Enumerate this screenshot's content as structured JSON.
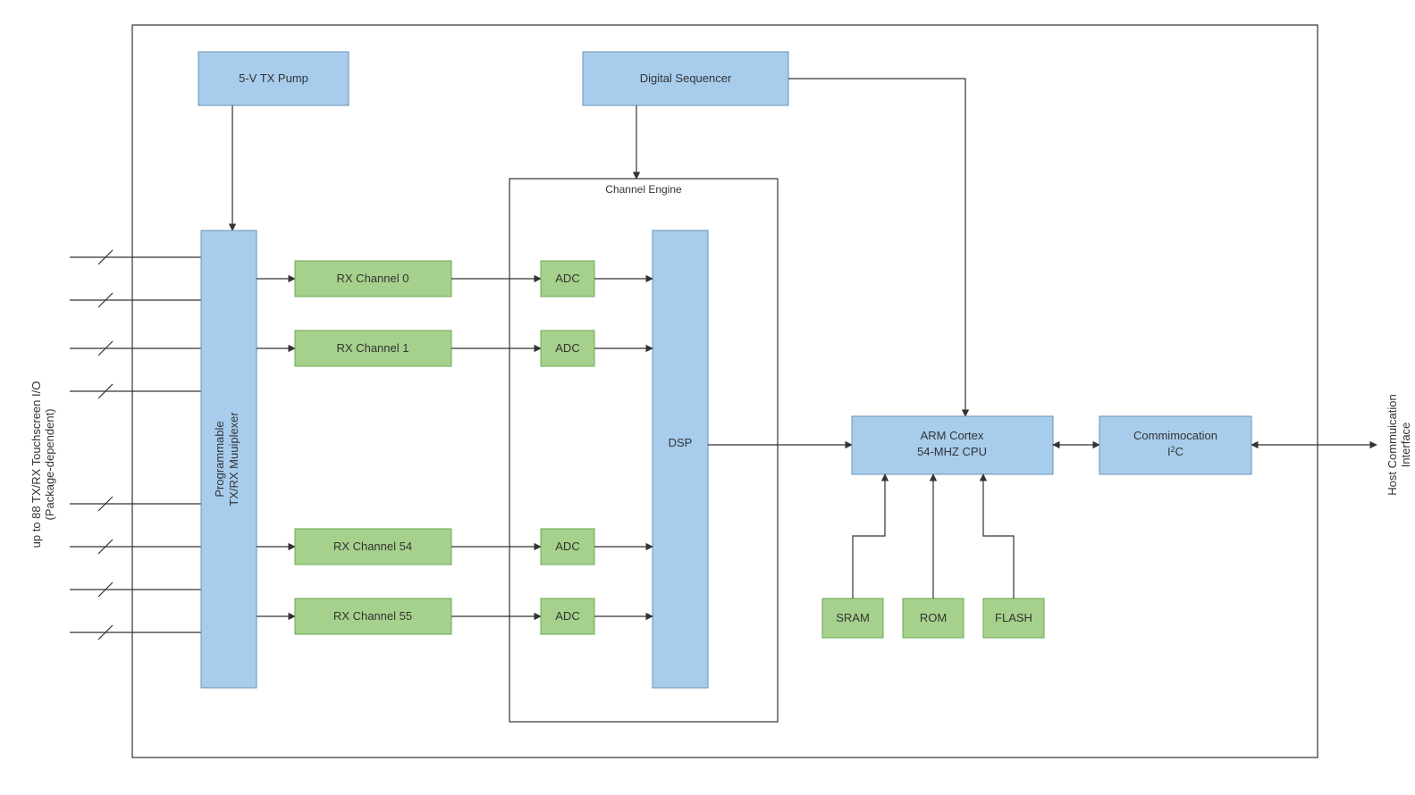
{
  "left_label_line1": "up to 88 TX/RX Touchscreen I/O",
  "left_label_line2": "(Package-dependent)",
  "right_label_line1": "Host Commuication",
  "right_label_line2": "Interface",
  "blocks": {
    "tx_pump": "5-V TX Pump",
    "digital_sequencer": "Digital Sequencer",
    "channel_engine_title": "Channel Engine",
    "mux_line1": "Programmable",
    "mux_line2": "TX/RX Muuiplexer",
    "rx0": "RX Channel 0",
    "rx1": "RX Channel 1",
    "rx54": "RX Channel 54",
    "rx55": "RX Channel 55",
    "adc": "ADC",
    "dsp": "DSP",
    "cpu_line1": "ARM Cortex",
    "cpu_line2": "54-MHZ CPU",
    "comm_line1": "Commimocation",
    "comm_line2_prefix": "I",
    "comm_line2_sup": "2",
    "comm_line2_suffix": "C",
    "sram": "SRAM",
    "rom": "ROM",
    "flash": "FLASH"
  }
}
